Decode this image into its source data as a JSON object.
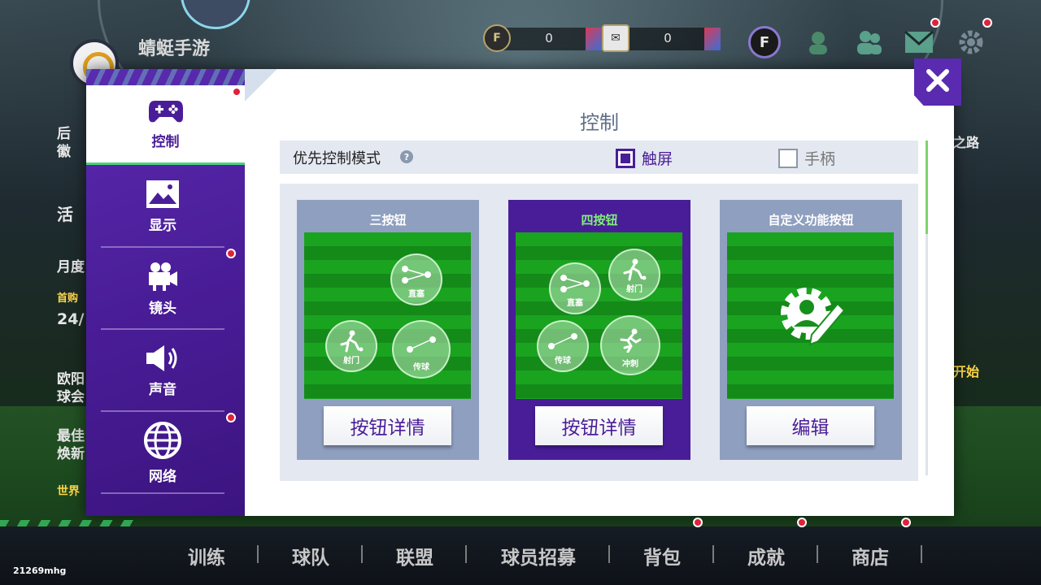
{
  "header": {
    "club_name": "蜻蜓手游",
    "currencies": [
      {
        "icon": "f-coin-icon",
        "amount": "0",
        "coin_label": "F"
      },
      {
        "icon": "ticket-icon",
        "amount": "0",
        "coin_label": "✉"
      }
    ],
    "f_logo": "F",
    "icons": [
      "f-logo-icon",
      "friends-icon",
      "mail-icon",
      "settings-icon"
    ]
  },
  "background_panels": {
    "left": [
      "后",
      "徽",
      "活",
      "月度",
      "首购",
      "24/",
      "欧阳",
      "球会",
      "最佳",
      "焕新",
      "世界"
    ],
    "right": [
      "之路",
      "开始"
    ]
  },
  "modal": {
    "title": "控制",
    "sidebar": [
      {
        "label": "控制",
        "icon": "gamepad-icon",
        "active": true,
        "badge": true
      },
      {
        "label": "显示",
        "icon": "image-icon",
        "active": false,
        "badge": false
      },
      {
        "label": "镜头",
        "icon": "camera-icon",
        "active": false,
        "badge": true
      },
      {
        "label": "声音",
        "icon": "speaker-icon",
        "active": false,
        "badge": false
      },
      {
        "label": "网络",
        "icon": "globe-icon",
        "active": false,
        "badge": true
      }
    ],
    "preference": {
      "label": "优先控制模式",
      "help": "?",
      "options": [
        {
          "label": "触屏",
          "checked": true
        },
        {
          "label": "手柄",
          "checked": false
        }
      ]
    },
    "modes": [
      {
        "title": "三按钮",
        "selected": false,
        "button": "按钮详情",
        "pads": [
          {
            "label": "直塞"
          },
          {
            "label": "射门"
          },
          {
            "label": "传球"
          }
        ]
      },
      {
        "title": "四按钮",
        "selected": true,
        "button": "按钮详情",
        "pads": [
          {
            "label": "射门"
          },
          {
            "label": "直塞"
          },
          {
            "label": "传球"
          },
          {
            "label": "冲刺"
          }
        ]
      },
      {
        "title": "自定义功能按钮",
        "selected": false,
        "button": "编辑",
        "icon": "gear-person-edit-icon"
      }
    ],
    "close_icon": "close-icon"
  },
  "bottom_nav": [
    {
      "label": "训练",
      "badge": false
    },
    {
      "label": "球队",
      "badge": false
    },
    {
      "label": "联盟",
      "badge": false
    },
    {
      "label": "球员招募",
      "badge": false
    },
    {
      "label": "背包",
      "badge": true
    },
    {
      "label": "成就",
      "badge": true
    },
    {
      "label": "商店",
      "badge": true
    }
  ],
  "version": "21269mhg",
  "colors": {
    "accent_purple": "#4a1d98",
    "accent_green": "#7ff07a",
    "badge_red": "#e0223a",
    "pitch_green": "#1aa31f"
  }
}
